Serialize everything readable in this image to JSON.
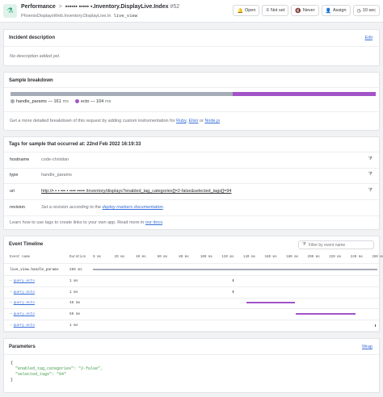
{
  "header": {
    "namespace": "Performance",
    "separator": ">",
    "action": "▪▪▪▪▪▪ ▪▪▪▪▪ ▪.Inventory.DisplayLive.Index",
    "incident_number": "#52",
    "subtitle": "PhoenixDisplaysWeb.Inventory.DisplayLive.In",
    "subtitle_tag": "live_view",
    "buttons": [
      {
        "name": "open-button",
        "icon": "bell-icon",
        "glyph": "🔔",
        "label": "Open"
      },
      {
        "name": "severity-button",
        "icon": "bars-icon",
        "glyph": "≡",
        "label": "Not set"
      },
      {
        "name": "notify-button",
        "icon": "mute-icon",
        "glyph": "🔇",
        "label": "Never"
      },
      {
        "name": "assign-button",
        "icon": "user-icon",
        "glyph": "👤",
        "label": "Assign"
      },
      {
        "name": "threshold-button",
        "icon": "clock-icon",
        "glyph": "◷",
        "label": "10 sec"
      }
    ]
  },
  "incident": {
    "title": "Incident description",
    "edit": "Edit",
    "body": "No description added yet."
  },
  "breakdown": {
    "title": "Sample breakdown",
    "items": [
      {
        "name": "handle_params",
        "ms": "161",
        "unit": "ms",
        "fraction": 0.6076,
        "color": "#a6acb7"
      },
      {
        "name": "ecto",
        "ms": "104",
        "unit": "ms",
        "fraction": 0.3924,
        "color": "#a253c8"
      }
    ],
    "hint_prefix": "Get a more detailed breakdown of this request by adding custom instrumentation for",
    "hint_links": [
      "Ruby",
      "Elixir",
      "Node.js"
    ],
    "hint_comma": ",",
    "hint_or": "or"
  },
  "tags": {
    "title": "Tags for sample that occurred at: 22nd Feb 2022 16:19:33",
    "rows": [
      {
        "key": "hostname",
        "value": "code-christian"
      },
      {
        "key": "type",
        "value": "handle_params"
      },
      {
        "key": "uri",
        "value": "http://▪ ▪ ▪ ▪▪▪ ▪ ▪▪▪▪ ▪▪▪▪▪ /inventory/displays?enabled_tag_categories[]=2-false&selected_tags[]=94"
      },
      {
        "key": "revision",
        "value_prefix": "Set a revision according to the",
        "value_link": "deploy markers documentation",
        "value_suffix": "."
      }
    ],
    "footer_prefix": "Learn how to use tags to create links to your own app. Read more in",
    "footer_link": "our docs",
    "footer_suffix": "."
  },
  "timeline": {
    "title": "Event Timeline",
    "filter_placeholder": "Filter by event name",
    "col_event": "Event name",
    "col_duration": "Duration",
    "ticks": [
      "0 ms",
      "20 ms",
      "40 ms",
      "60 ms",
      "80 ms",
      "100 ms",
      "120 ms",
      "140 ms",
      "160 ms",
      "180 ms",
      "200 ms",
      "220 ms",
      "240 ms",
      "260 ms"
    ],
    "max_ms": 265,
    "rows": [
      {
        "name": "live_view.handle_params",
        "duration": "265 ms",
        "start": 0,
        "length": 265,
        "color": "gray",
        "child": false
      },
      {
        "name": "query.ecto",
        "duration": "1 ms",
        "start": 130,
        "length": 1,
        "color": "tick",
        "child": true
      },
      {
        "name": "query.ecto",
        "duration": "1 ms",
        "start": 130,
        "length": 1,
        "color": "tick",
        "child": true
      },
      {
        "name": "query.ecto",
        "duration": "45 ms",
        "start": 143,
        "length": 45,
        "color": "purple",
        "child": true
      },
      {
        "name": "query.ecto",
        "duration": "56 ms",
        "start": 189,
        "length": 56,
        "color": "purple",
        "child": true
      },
      {
        "name": "query.ecto",
        "duration": "1 ms",
        "start": 263,
        "length": 1,
        "color": "tick",
        "child": true
      }
    ]
  },
  "params": {
    "title": "Parameters",
    "wrap": "Wrap",
    "lines": [
      "{",
      "  \"enabled_tag_categories\": \"2-false\",",
      "  \"selected_tags\": \"94\"",
      "}"
    ]
  }
}
